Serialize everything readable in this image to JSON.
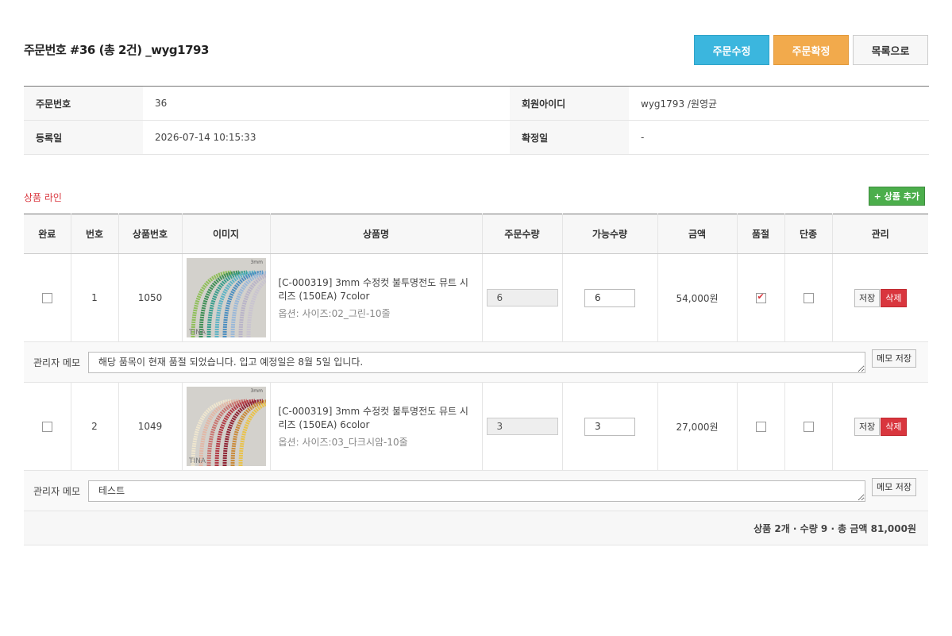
{
  "header": {
    "title": "주문번호 #36 (총 2건) _wyg1793",
    "buttons": {
      "edit": "주문수정",
      "confirm": "주문확정",
      "list": "목록으로"
    }
  },
  "info": {
    "order_no_label": "주문번호",
    "order_no": "36",
    "member_label": "회원아이디",
    "member": "wyg1793 /원영균",
    "reg_label": "등록일",
    "reg_date": "2026-07-14 10:15:33",
    "confirm_label": "확정일",
    "confirm_date": "-"
  },
  "section": {
    "title": "상품 라인",
    "add_button": "+ 상품 추가"
  },
  "columns": [
    "완료",
    "번호",
    "상품번호",
    "이미지",
    "상품명",
    "주문수량",
    "가능수량",
    "금액",
    "품절",
    "단종",
    "관리"
  ],
  "items": [
    {
      "num": "1",
      "goods_no": "1050",
      "name": "[C-000319] 3mm 수정컷 불투명전도 뮤트 시리즈 (150EA) 7color",
      "option": "옵션: 사이즈:02_그린-10줄",
      "order_qty": "6",
      "avail_qty": "6",
      "amount": "54,000원",
      "done": false,
      "soldout": true,
      "discontinued": false,
      "image": {
        "label_top": "3mm",
        "label_bottom": "TINA",
        "colors": [
          "#8fbf5a",
          "#3f8f56",
          "#3a9e8c",
          "#5fb3c4",
          "#4d8fc0",
          "#9ab8d8",
          "#b9b4c8",
          "#c9c4d0"
        ]
      },
      "memo_label": "관리자 메모",
      "memo": "해당 품목이 현재 품절 되었습니다. 입고 예정일은 8월 5일 입니다.",
      "memo_button": "메모 저장"
    },
    {
      "num": "2",
      "goods_no": "1049",
      "name": "[C-000319] 3mm 수정컷 불투명전도 뮤트 시리즈 (150EA) 6color",
      "option": "옵션: 사이즈:03_다크시암-10줄",
      "order_qty": "3",
      "avail_qty": "3",
      "amount": "27,000원",
      "done": false,
      "soldout": false,
      "discontinued": false,
      "image": {
        "label_top": "3mm",
        "label_bottom": "TINA",
        "colors": [
          "#efe6cf",
          "#e2b7a6",
          "#c9736f",
          "#b23a45",
          "#8f2434",
          "#c98a3a",
          "#e9c24a"
        ]
      },
      "memo_label": "관리자 메모",
      "memo": "테스트",
      "memo_button": "메모 저장"
    }
  ],
  "row_buttons": {
    "save": "저장",
    "delete": "삭제"
  },
  "summary": "상품 2개 · 수량 9 · 총 금액 81,000원",
  "colors": {
    "accent_blue": "#3bb6de",
    "accent_orange": "#f2aa4c",
    "danger": "#d9363e",
    "success": "#4cae4c"
  }
}
